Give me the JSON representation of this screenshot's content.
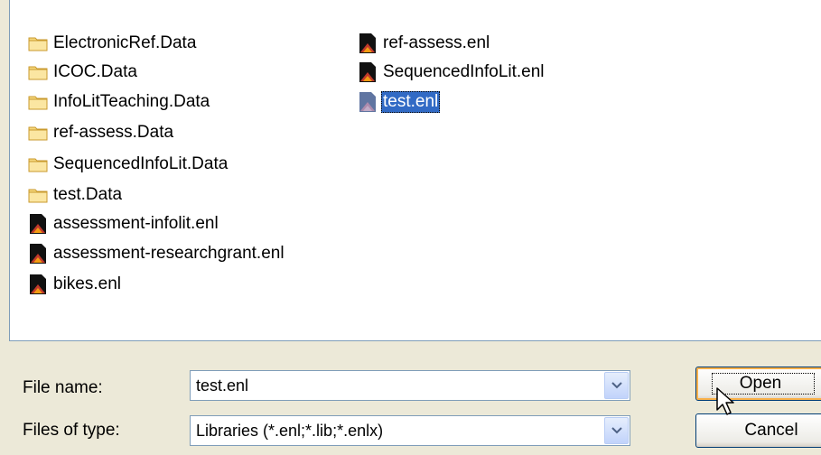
{
  "files": {
    "col1": [
      {
        "name": "ElectronicRef.Data",
        "kind": "folder"
      },
      {
        "name": "ICOC.Data",
        "kind": "folder"
      },
      {
        "name": "InfoLitTeaching.Data",
        "kind": "folder"
      },
      {
        "name": "ref-assess.Data",
        "kind": "folder"
      },
      {
        "name": "SequencedInfoLit.Data",
        "kind": "folder"
      },
      {
        "name": "test.Data",
        "kind": "folder"
      },
      {
        "name": "assessment-infolit.enl",
        "kind": "enl"
      },
      {
        "name": "assessment-researchgrant.enl",
        "kind": "enl"
      },
      {
        "name": "bikes.enl",
        "kind": "enl"
      }
    ],
    "col2": [
      {
        "name": "ref-assess.enl",
        "kind": "enl"
      },
      {
        "name": "SequencedInfoLit.enl",
        "kind": "enl"
      },
      {
        "name": "test.enl",
        "kind": "enl",
        "selected": true
      }
    ]
  },
  "form": {
    "file_name_label": "File name:",
    "file_name_value": "test.enl",
    "file_type_label": "Files of type:",
    "file_type_value": "Libraries (*.enl;*.lib;*.enlx)"
  },
  "buttons": {
    "open": "Open",
    "cancel": "Cancel"
  },
  "icons": {
    "folder": "folder-icon",
    "enl": "endnote-library-icon",
    "dropdown": "chevron-down-icon",
    "cursor": "mouse-pointer-icon"
  },
  "colors": {
    "selection": "#316ac5",
    "dialog_bg": "#ece9d8",
    "border": "#7f9db9"
  }
}
